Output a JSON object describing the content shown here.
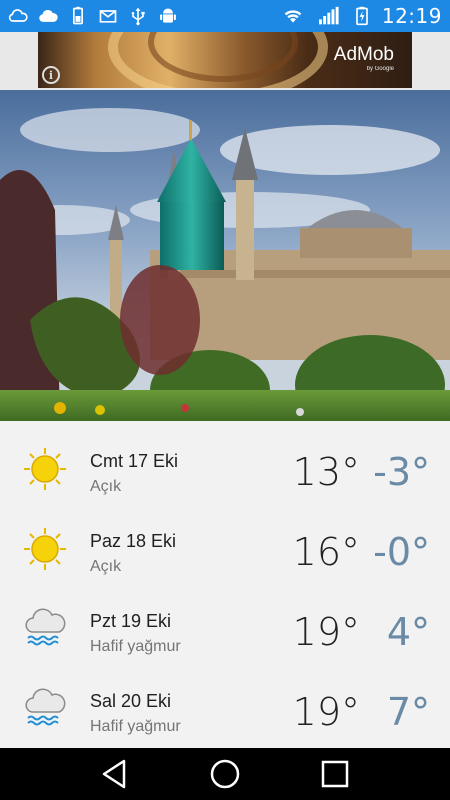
{
  "status_bar": {
    "time": "12:19",
    "left_icons": [
      "cloud-icon",
      "weather-cloud-icon",
      "battery-usb-icon",
      "email-icon",
      "usb-icon",
      "android-debug-icon"
    ],
    "right_icons": [
      "wifi-icon",
      "signal-icon",
      "battery-charging-icon"
    ]
  },
  "ad": {
    "brand": "AdMob",
    "by": "by Google",
    "info": "i"
  },
  "forecast": [
    {
      "date": "Cmt 17 Eki",
      "desc": "Açık",
      "high": "13°",
      "low": "-3°",
      "icon": "sun-icon"
    },
    {
      "date": "Paz 18 Eki",
      "desc": "Açık",
      "high": "16°",
      "low": "-0°",
      "icon": "sun-icon"
    },
    {
      "date": "Pzt 19 Eki",
      "desc": "Hafif yağmur",
      "high": "19°",
      "low": "4°",
      "icon": "light-rain-icon"
    },
    {
      "date": "Sal 20 Eki",
      "desc": "Hafif yağmur",
      "high": "19°",
      "low": "7°",
      "icon": "light-rain-icon"
    }
  ],
  "colors": {
    "status_bar": "#1e88e5",
    "low_temp": "#6a8aa6",
    "nav_bar": "#000000"
  }
}
